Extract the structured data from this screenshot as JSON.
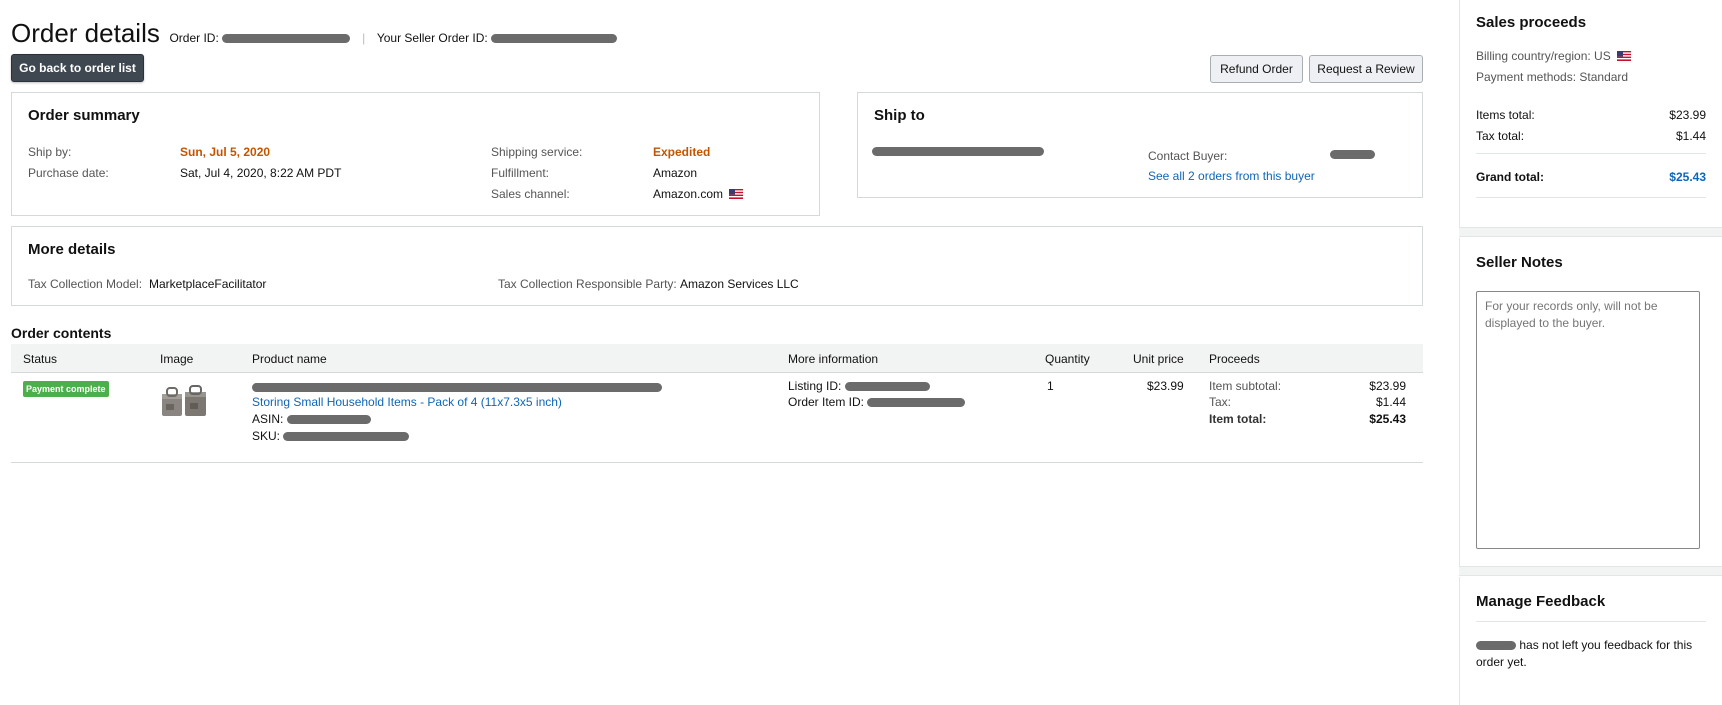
{
  "header": {
    "title": "Order details",
    "order_id_label": "Order ID:",
    "seller_order_id_label": "Your Seller Order ID:"
  },
  "actions": {
    "back": "Go back to order list",
    "refund": "Refund Order",
    "review": "Request a Review"
  },
  "order_summary": {
    "title": "Order summary",
    "ship_by_label": "Ship by:",
    "ship_by": "Sun, Jul 5, 2020",
    "purchase_date_label": "Purchase date:",
    "purchase_date": "Sat, Jul 4, 2020, 8:22 AM PDT",
    "shipping_service_label": "Shipping service:",
    "shipping_service": "Expedited",
    "fulfillment_label": "Fulfillment:",
    "fulfillment": "Amazon",
    "sales_channel_label": "Sales channel:",
    "sales_channel": "Amazon.com"
  },
  "ship_to": {
    "title": "Ship to",
    "contact_buyer_label": "Contact Buyer:",
    "see_all_orders": "See all 2 orders from this buyer"
  },
  "more_details": {
    "title": "More details",
    "tax_model_label": "Tax Collection Model:",
    "tax_model": "MarketplaceFacilitator",
    "tax_party_label": "Tax Collection Responsible Party:",
    "tax_party": "Amazon Services LLC"
  },
  "order_contents": {
    "title": "Order contents",
    "columns": [
      "Status",
      "Image",
      "Product name",
      "More information",
      "Quantity",
      "Unit price",
      "Proceeds"
    ],
    "rows": [
      {
        "status": "Payment complete",
        "product_link": "Storing Small Household Items - Pack of 4 (11x7.3x5 inch)",
        "asin_label": "ASIN:",
        "sku_label": "SKU:",
        "listing_id_label": "Listing ID:",
        "order_item_id_label": "Order Item ID:",
        "quantity": "1",
        "unit_price": "$23.99",
        "item_subtotal_label": "Item subtotal:",
        "item_subtotal": "$23.99",
        "tax_label": "Tax:",
        "tax": "$1.44",
        "item_total_label": "Item total:",
        "item_total": "$25.43"
      }
    ]
  },
  "sales_proceeds": {
    "title": "Sales proceeds",
    "billing_label": "Billing country/region: US",
    "payment_methods": "Payment methods: Standard",
    "items_total_label": "Items total:",
    "items_total": "$23.99",
    "tax_total_label": "Tax total:",
    "tax_total": "$1.44",
    "grand_total_label": "Grand total:",
    "grand_total": "$25.43"
  },
  "seller_notes": {
    "title": "Seller Notes",
    "placeholder": "For your records only, will not be displayed to the buyer."
  },
  "manage_feedback": {
    "title": "Manage Feedback",
    "message_part1": "has not left you feedback for this",
    "message_part2": "order yet."
  },
  "colors": {
    "accent_orange": "#c45500",
    "link_blue": "#0f66b8",
    "badge_green": "#4cae4c",
    "dark_button": "#3f4851"
  }
}
